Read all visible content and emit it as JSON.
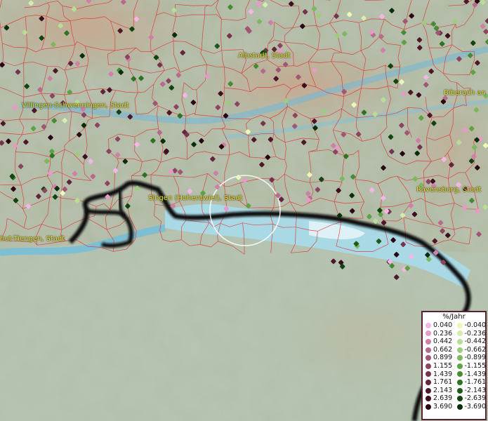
{
  "map": {
    "cities": [
      {
        "name": "Albstadt, Stadt",
        "pos": "top-center"
      },
      {
        "name": "Villingen-Schwenningen, Stadt",
        "pos": "left"
      },
      {
        "name": "Biberach an",
        "pos": "right"
      },
      {
        "name": "Singen (Hohentwiel), Stadt",
        "pos": "center"
      },
      {
        "name": "Ravensburg, Stadt",
        "pos": "right"
      },
      {
        "name": "hut-Tiengen, Stadt",
        "pos": "left"
      }
    ]
  },
  "legend": {
    "title": "%/Jahr",
    "positive": [
      {
        "label": "0.040",
        "color": "#f4b6e4"
      },
      {
        "label": "0.236",
        "color": "#e69ac8"
      },
      {
        "label": "0.442",
        "color": "#cf7fa8"
      },
      {
        "label": "0.662",
        "color": "#b86a8c"
      },
      {
        "label": "0.899",
        "color": "#a05674"
      },
      {
        "label": "1.155",
        "color": "#8c4460"
      },
      {
        "label": "1.439",
        "color": "#77334c"
      },
      {
        "label": "1.761",
        "color": "#63253a"
      },
      {
        "label": "2.143",
        "color": "#4e172a"
      },
      {
        "label": "2.639",
        "color": "#3c0e1e"
      },
      {
        "label": "3.690",
        "color": "#2a0612"
      }
    ],
    "negative": [
      {
        "label": "-0.040",
        "color": "#eef6b8"
      },
      {
        "label": "-0.236",
        "color": "#d4ecae"
      },
      {
        "label": "-0.442",
        "color": "#b8de96"
      },
      {
        "label": "-0.662",
        "color": "#9ccd7c"
      },
      {
        "label": "-0.899",
        "color": "#7cb860"
      },
      {
        "label": "-1.155",
        "color": "#5ea248"
      },
      {
        "label": "-1.439",
        "color": "#468c36"
      },
      {
        "label": "-1.761",
        "color": "#2e7224"
      },
      {
        "label": "-2.143",
        "color": "#1e5a18"
      },
      {
        "label": "-2.639",
        "color": "#124412"
      },
      {
        "label": "-3.690",
        "color": "#082e0a"
      }
    ]
  }
}
